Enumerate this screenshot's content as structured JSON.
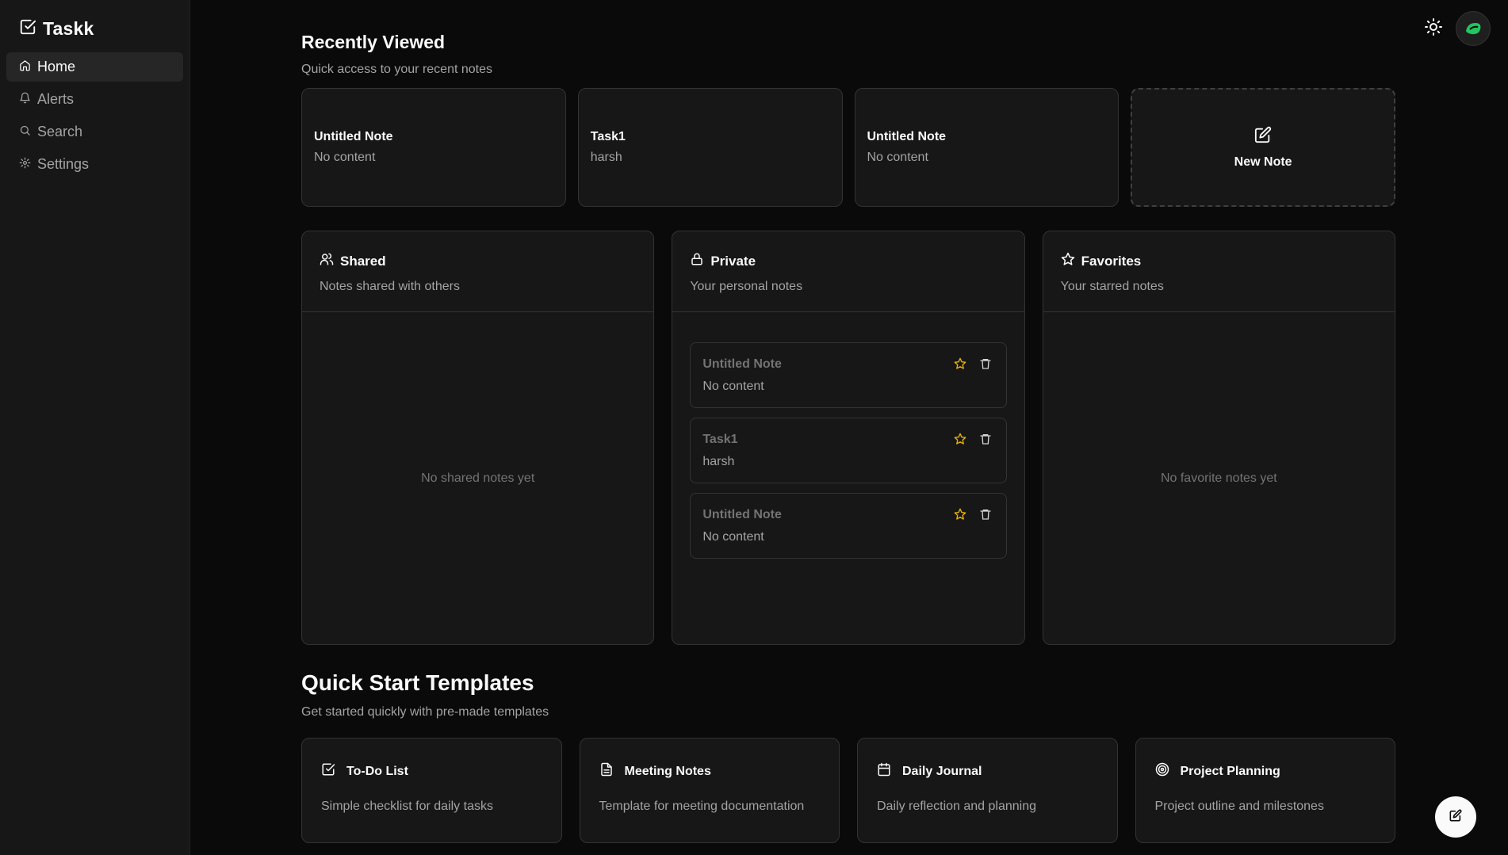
{
  "app": {
    "name": "Taskk"
  },
  "nav": [
    {
      "label": "Home",
      "icon": "home-icon",
      "active": true
    },
    {
      "label": "Alerts",
      "icon": "bell-icon"
    },
    {
      "label": "Search",
      "icon": "search-icon"
    },
    {
      "label": "Settings",
      "icon": "gear-icon"
    }
  ],
  "recent": {
    "title": "Recently Viewed",
    "subtitle": "Quick access to your recent notes",
    "cards": [
      {
        "title": "Untitled Note",
        "desc": "No content"
      },
      {
        "title": "Task1",
        "desc": "harsh"
      },
      {
        "title": "Untitled Note",
        "desc": "No content"
      }
    ],
    "new_label": "New Note"
  },
  "panels": {
    "shared": {
      "title": "Shared",
      "desc": "Notes shared with others",
      "empty": "No shared notes yet"
    },
    "private": {
      "title": "Private",
      "desc": "Your personal notes",
      "items": [
        {
          "title": "Untitled Note",
          "desc": "No content"
        },
        {
          "title": "Task1",
          "desc": "harsh"
        },
        {
          "title": "Untitled Note",
          "desc": "No content"
        }
      ]
    },
    "favorites": {
      "title": "Favorites",
      "desc": "Your starred notes",
      "empty": "No favorite notes yet"
    }
  },
  "templates": {
    "title": "Quick Start Templates",
    "subtitle": "Get started quickly with pre-made templates",
    "items": [
      {
        "title": "To-Do List",
        "desc": "Simple checklist for daily tasks",
        "icon": "checkbox-icon"
      },
      {
        "title": "Meeting Notes",
        "desc": "Template for meeting documentation",
        "icon": "document-icon"
      },
      {
        "title": "Daily Journal",
        "desc": "Daily reflection and planning",
        "icon": "calendar-icon"
      },
      {
        "title": "Project Planning",
        "desc": "Project outline and milestones",
        "icon": "target-icon"
      }
    ]
  },
  "colors": {
    "background": "#0a0a0a",
    "card": "#171717",
    "border": "#333333",
    "star": "#eab308",
    "muted": "#a3a3a3"
  }
}
